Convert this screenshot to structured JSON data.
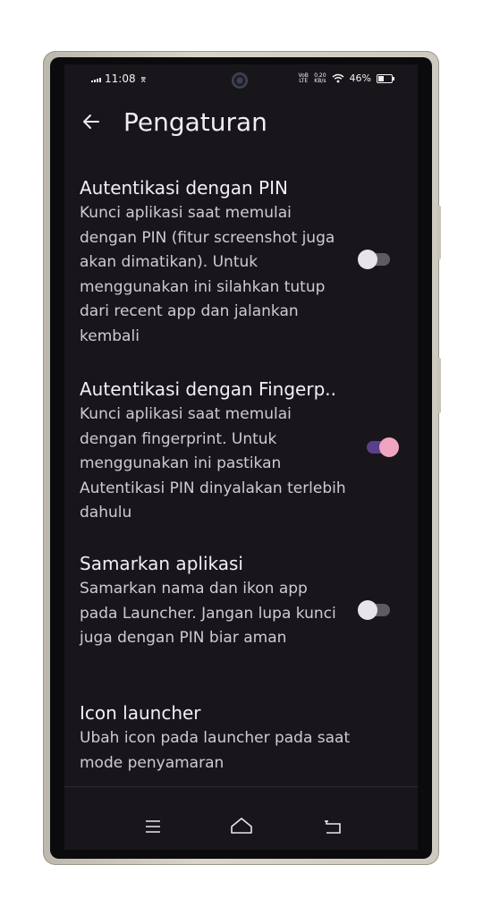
{
  "status_bar": {
    "time": "11:08",
    "download_indicator": "⌆",
    "network_speed": "0.20",
    "network_speed_unit": "KB/s",
    "network_type": "VoB LTE",
    "battery_percent": "46%",
    "battery_level": 0.46
  },
  "app_bar": {
    "title": "Pengaturan",
    "back_icon": "arrow-left-icon"
  },
  "settings": [
    {
      "title": "Autentikasi dengan PIN",
      "description": "Kunci aplikasi saat memulai dengan PIN (fitur screenshot juga akan dimatikan). Untuk menggunakan ini silahkan tutup dari recent app dan jalankan kembali",
      "toggle": "off"
    },
    {
      "title": "Autentikasi dengan Fingerp..",
      "description": "Kunci aplikasi saat memulai dengan fingerprint. Untuk menggunakan ini pastikan Autentikasi PIN dinyalakan terlebih dahulu",
      "toggle": "on"
    },
    {
      "title": "Samarkan aplikasi",
      "description": "Samarkan nama dan ikon app pada Launcher. Jangan lupa kunci juga dengan PIN biar aman",
      "toggle": "off"
    },
    {
      "title": "Icon launcher",
      "description": "Ubah icon pada launcher pada saat mode penyamaran"
    }
  ],
  "nav_bar": {
    "recents_icon": "menu-lines-icon",
    "home_icon": "home-icon",
    "back_icon": "back-icon"
  },
  "colors": {
    "background": "#18161b",
    "toggle_on_thumb": "#f1a4bf",
    "toggle_on_track": "#5a3f8a",
    "toggle_off_thumb": "#e7e4ea",
    "toggle_off_track": "#5e5b62"
  }
}
